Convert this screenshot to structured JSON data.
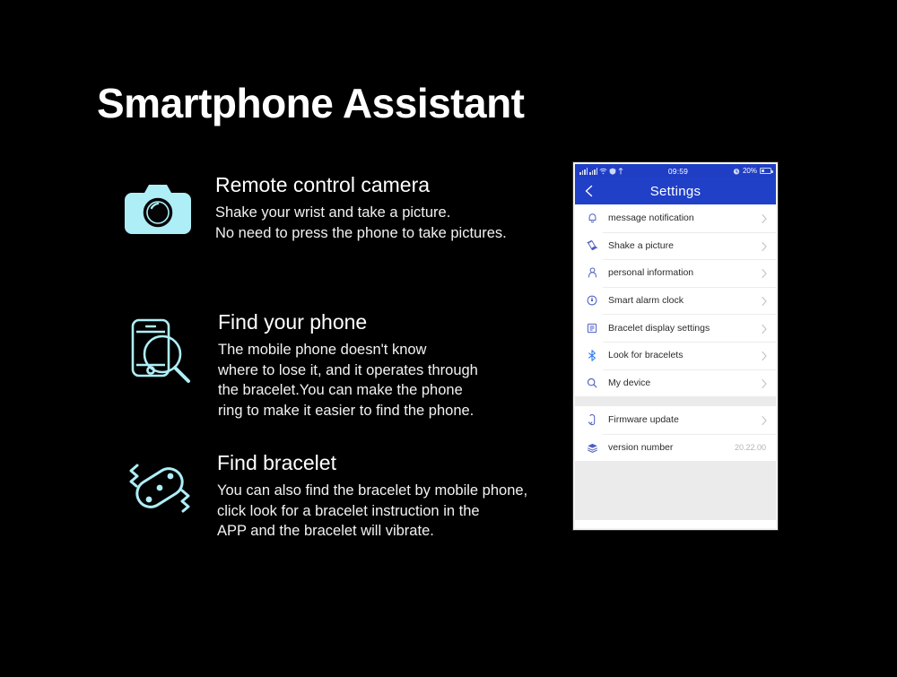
{
  "page": {
    "title": "Smartphone Assistant",
    "background_color": "#000000",
    "accent_icon_color": "#aeeef7"
  },
  "features": [
    {
      "icon": "camera-icon",
      "heading": "Remote control camera",
      "description": "Shake your wrist and take a picture.\nNo need to press the phone to take pictures."
    },
    {
      "icon": "find-phone-icon",
      "heading": "Find your phone",
      "description": "The mobile phone doesn't know\nwhere to lose it, and it operates through\nthe bracelet.You can make the phone\nring to make it easier to find the phone."
    },
    {
      "icon": "find-bracelet-icon",
      "heading": "Find bracelet",
      "description": "You can also find the bracelet by mobile phone,\n click  look for a bracelet instruction in the\nAPP and the bracelet will vibrate."
    }
  ],
  "phone": {
    "status_bar": {
      "time": "09:59",
      "battery_percent": "20%",
      "icons": [
        "signal-bars-icon",
        "signal-bars-icon",
        "wifi-icon",
        "vpn-icon",
        "location-icon",
        "alarm-icon",
        "battery-icon"
      ]
    },
    "nav": {
      "back_icon": "chevron-left-icon",
      "title": "Settings"
    },
    "settings_groups": [
      {
        "rows": [
          {
            "icon": "bell-icon",
            "label": "message notification",
            "value": "",
            "chevron": true
          },
          {
            "icon": "shake-icon",
            "label": "Shake a picture",
            "value": "",
            "chevron": true
          },
          {
            "icon": "person-icon",
            "label": "personal information",
            "value": "",
            "chevron": true
          },
          {
            "icon": "clock-icon",
            "label": "Smart alarm clock",
            "value": "",
            "chevron": true
          },
          {
            "icon": "display-icon",
            "label": "Bracelet display settings",
            "value": "",
            "chevron": true
          },
          {
            "icon": "bluetooth-icon",
            "label": "Look for bracelets",
            "value": "",
            "chevron": true
          },
          {
            "icon": "search-icon",
            "label": "My device",
            "value": "",
            "chevron": true
          }
        ]
      },
      {
        "rows": [
          {
            "icon": "firmware-icon",
            "label": "Firmware update",
            "value": "",
            "chevron": true
          },
          {
            "icon": "layers-icon",
            "label": "version number",
            "value": "20.22.00",
            "chevron": false
          }
        ]
      }
    ],
    "colors": {
      "nav_blue": "#2040c8",
      "status_blue": "#1f3ec4",
      "row_icon": "#4d5fc0",
      "page_bg": "#ebebeb"
    }
  }
}
